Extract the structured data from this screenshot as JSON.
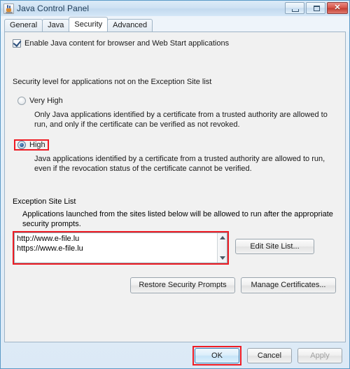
{
  "window": {
    "title": "Java Control Panel",
    "icon": "java-cup-icon",
    "controls": {
      "minimize": "minimize-icon",
      "maximize": "maximize-icon",
      "close": "✕"
    }
  },
  "tabs": [
    {
      "label": "General",
      "active": false
    },
    {
      "label": "Java",
      "active": false
    },
    {
      "label": "Security",
      "active": true
    },
    {
      "label": "Advanced",
      "active": false
    }
  ],
  "security": {
    "enable_checkbox": {
      "label": "Enable Java content for browser and Web Start applications",
      "checked": true
    },
    "level_heading": "Security level for applications not on the Exception Site list",
    "levels": [
      {
        "label": "Very High",
        "selected": false,
        "highlighted": false,
        "description": "Only Java applications identified by a certificate from a trusted authority are allowed to run, and only if the certificate can be verified as not revoked."
      },
      {
        "label": "High",
        "selected": true,
        "highlighted": true,
        "description": "Java applications identified by a certificate from a trusted authority are allowed to run, even if the revocation status of the certificate cannot be verified."
      }
    ],
    "exception_list": {
      "heading": "Exception Site List",
      "description": "Applications launched from the sites listed below will be allowed to run after the appropriate security prompts.",
      "sites": [
        "http://www.e-file.lu",
        "https://www.e-file.lu"
      ],
      "edit_button": "Edit Site List...",
      "highlighted": true
    },
    "buttons": {
      "restore": "Restore Security Prompts",
      "manage_certificates": "Manage Certificates..."
    }
  },
  "footer": {
    "ok": "OK",
    "cancel": "Cancel",
    "apply": "Apply",
    "apply_disabled": true,
    "ok_highlighted": true
  },
  "colors": {
    "highlight": "#ee1c24",
    "title_text": "#1c3b57",
    "panel_bg": "#f1f1f1",
    "window_border": "#5b9ac7"
  }
}
